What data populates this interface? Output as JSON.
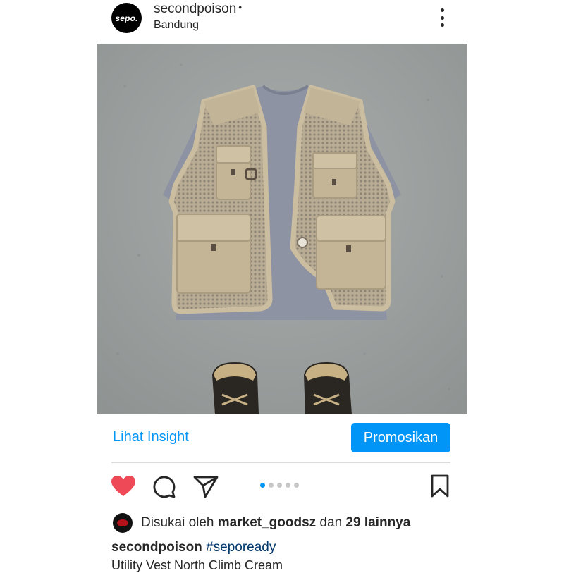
{
  "post": {
    "avatar_text": "sepo.",
    "username": "secondpoison",
    "username_dot": "•",
    "location": "Bandung",
    "more_icon": "more-vertical-icon",
    "image_subject": "photo"
  },
  "insights": {
    "link_label": "Lihat Insight",
    "promote_label": "Promosikan"
  },
  "actions": {
    "icons": [
      "heart-icon",
      "comment-icon",
      "share-icon",
      "bookmark-icon"
    ],
    "liked": true,
    "carousel": {
      "count": 5,
      "active_index": 0
    }
  },
  "likes": {
    "prefix": "Disukai oleh ",
    "user": "market_goodsz",
    "middle": " dan ",
    "others": "29 lainnya"
  },
  "caption": {
    "username": "secondpoison",
    "hashtag": "#sepoready",
    "body": "Utility Vest North Climb Cream"
  },
  "colors": {
    "accent": "#0095f6",
    "like_red": "#ed4956",
    "hashtag": "#00376b",
    "text": "#262626"
  }
}
